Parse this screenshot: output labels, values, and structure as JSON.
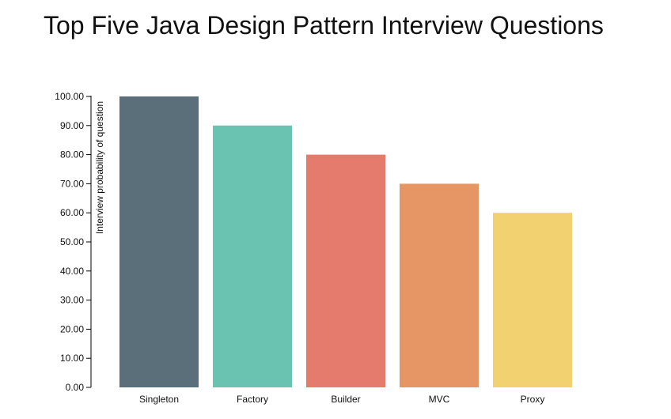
{
  "chart_data": {
    "type": "bar",
    "title": "Top Five Java Design Pattern Interview Questions",
    "xlabel": "",
    "ylabel": "Interview probability of question",
    "categories": [
      "Singleton",
      "Factory",
      "Builder",
      "MVC",
      "Proxy"
    ],
    "values": [
      100,
      90,
      80,
      70,
      60
    ],
    "colors": [
      "#5b6f7b",
      "#6ac2b0",
      "#e57b6c",
      "#e69565",
      "#f2d270"
    ],
    "ylim": [
      0,
      100
    ],
    "yticks": [
      "0.00",
      "10.00",
      "20.00",
      "30.00",
      "40.00",
      "50.00",
      "60.00",
      "70.00",
      "80.00",
      "90.00",
      "100.00"
    ],
    "grid": false,
    "legend": "none"
  }
}
